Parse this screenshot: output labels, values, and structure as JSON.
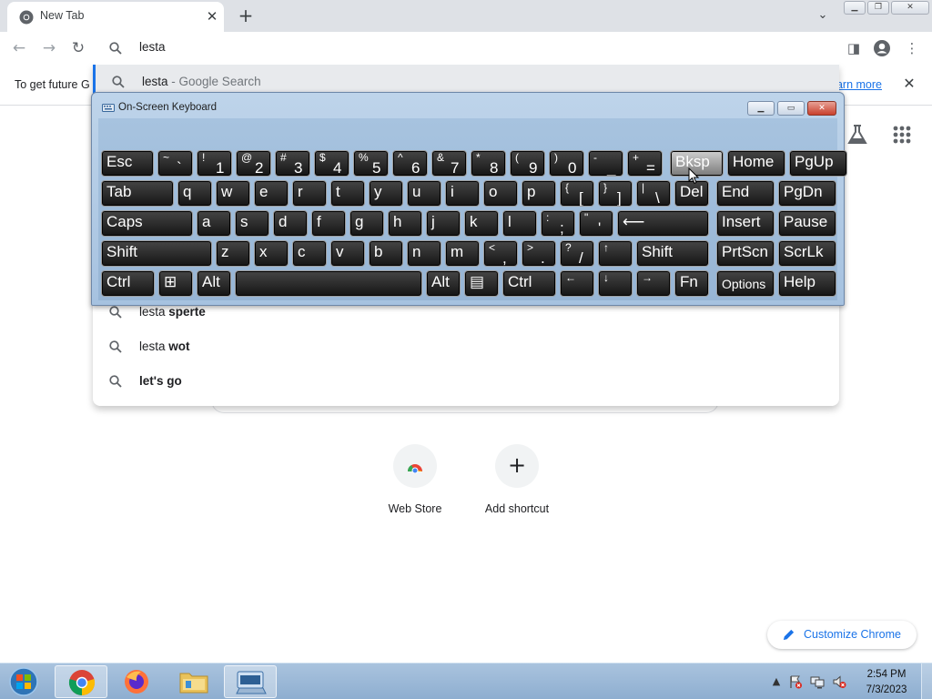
{
  "browser": {
    "tab_title": "New Tab",
    "omnibox_text": "lesta",
    "infobar_text": "To get future G",
    "infobar_link": "earn more"
  },
  "suggestions": [
    {
      "prefix": "lesta",
      "bold": "",
      "suffix": " - Google Search",
      "selected": true
    },
    {
      "prefix": "lesta ",
      "bold": "sperte",
      "suffix": "",
      "selected": false
    },
    {
      "prefix": "lesta ",
      "bold": "wot",
      "suffix": "",
      "selected": false
    },
    {
      "prefix": "",
      "bold": "let's go",
      "suffix": "",
      "selected": false
    }
  ],
  "ntp": {
    "shortcuts": [
      {
        "label": "Web Store",
        "icon": "web-store-icon"
      },
      {
        "label": "Add shortcut",
        "icon": "plus-icon"
      }
    ],
    "customize_label": "Customize Chrome"
  },
  "osk": {
    "title": "On-Screen Keyboard",
    "rows": [
      [
        {
          "t": "",
          "m": "Esc"
        },
        {
          "t": "~",
          "b": "`"
        },
        {
          "t": "!",
          "b": "1"
        },
        {
          "t": "@",
          "b": "2"
        },
        {
          "t": "#",
          "b": "3"
        },
        {
          "t": "$",
          "b": "4"
        },
        {
          "t": "%",
          "b": "5"
        },
        {
          "t": "^",
          "b": "6"
        },
        {
          "t": "&",
          "b": "7"
        },
        {
          "t": "*",
          "b": "8"
        },
        {
          "t": "(",
          "b": "9"
        },
        {
          "t": ")",
          "b": "0"
        },
        {
          "t": "-",
          "b": "_"
        },
        {
          "t": "+",
          "b": "="
        },
        {
          "m": "Bksp",
          "hot": true
        },
        {
          "m": "Home"
        },
        {
          "m": "PgUp"
        }
      ],
      [
        {
          "m": "Tab"
        },
        {
          "m": "q"
        },
        {
          "m": "w"
        },
        {
          "m": "e"
        },
        {
          "m": "r"
        },
        {
          "m": "t"
        },
        {
          "m": "y"
        },
        {
          "m": "u"
        },
        {
          "m": "i"
        },
        {
          "m": "o"
        },
        {
          "m": "p"
        },
        {
          "t": "{",
          "b": "["
        },
        {
          "t": "}",
          "b": "]"
        },
        {
          "t": "|",
          "b": "\\"
        },
        {
          "m": "Del"
        },
        {
          "m": "End"
        },
        {
          "m": "PgDn"
        }
      ],
      [
        {
          "m": "Caps"
        },
        {
          "m": "a"
        },
        {
          "m": "s"
        },
        {
          "m": "d"
        },
        {
          "m": "f"
        },
        {
          "m": "g"
        },
        {
          "m": "h"
        },
        {
          "m": "j"
        },
        {
          "m": "k"
        },
        {
          "m": "l"
        },
        {
          "t": ":",
          "b": ";"
        },
        {
          "t": "\"",
          "b": "'"
        },
        {
          "m": "⟵"
        },
        {
          "m": "Insert"
        },
        {
          "m": "Pause"
        }
      ],
      [
        {
          "m": "Shift"
        },
        {
          "m": "z"
        },
        {
          "m": "x"
        },
        {
          "m": "c"
        },
        {
          "m": "v"
        },
        {
          "m": "b"
        },
        {
          "m": "n"
        },
        {
          "m": "m"
        },
        {
          "t": "<",
          "b": ","
        },
        {
          "t": ">",
          "b": "."
        },
        {
          "t": "?",
          "b": "/"
        },
        {
          "t": "↑",
          "b": ""
        },
        {
          "m": "Shift"
        },
        {
          "m": "PrtScn"
        },
        {
          "m": "ScrLk"
        }
      ],
      [
        {
          "m": "Ctrl"
        },
        {
          "m": "⊞"
        },
        {
          "m": "Alt"
        },
        {
          "m": ""
        },
        {
          "m": "Alt"
        },
        {
          "m": "▤"
        },
        {
          "m": "Ctrl"
        },
        {
          "t": "←",
          "b": ""
        },
        {
          "t": "↓",
          "b": ""
        },
        {
          "t": "→",
          "b": ""
        },
        {
          "m": "Fn"
        },
        {
          "m": "Options",
          "sm": true
        },
        {
          "m": "Help"
        }
      ]
    ]
  },
  "taskbar": {
    "time": "2:54 PM",
    "date": "7/3/2023"
  },
  "colors": {
    "accent": "#1a73e8",
    "key_face": "#151515",
    "osk_frame": "#a6c2e0",
    "taskbar": "#a9c3de"
  }
}
